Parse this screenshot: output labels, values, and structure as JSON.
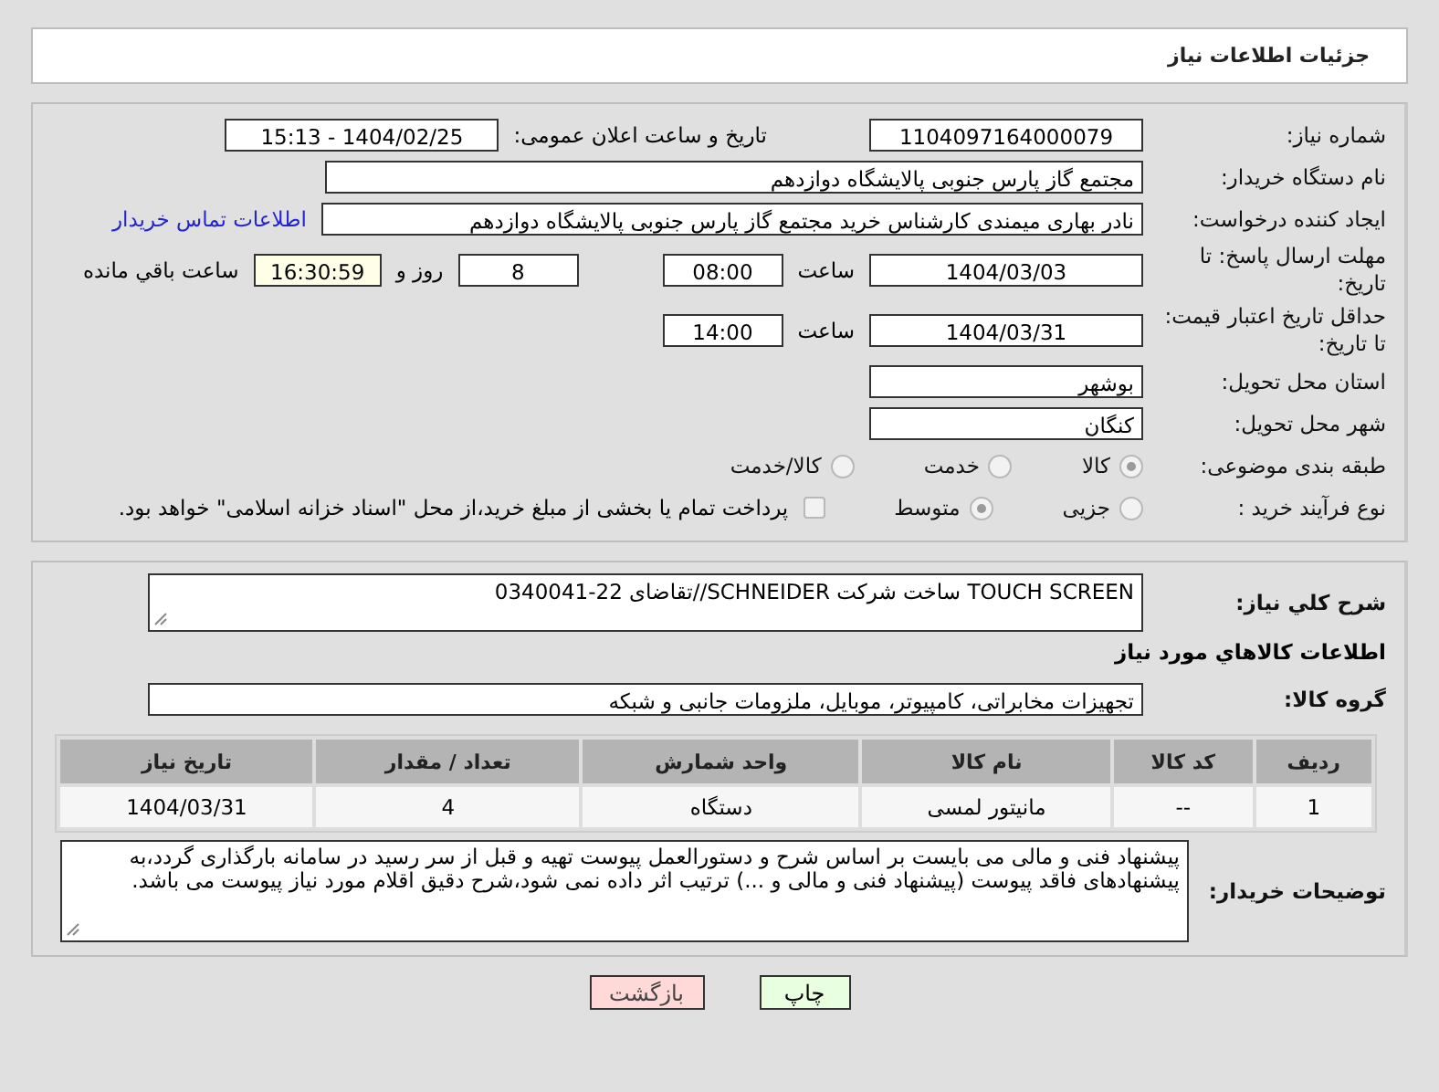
{
  "header": {
    "title": "جزئیات اطلاعات نیاز"
  },
  "need_number": {
    "label": "شماره نیاز:",
    "value": "1104097164000079"
  },
  "announce": {
    "label": "تاریخ و ساعت اعلان عمومی:",
    "value": "1404/02/25 - 15:13"
  },
  "buyer": {
    "label": "نام دستگاه خریدار:",
    "value": "مجتمع گاز پارس جنوبی  پالایشگاه دوازدهم"
  },
  "creator": {
    "label": "ایجاد کننده درخواست:",
    "value": "نادر بهاری میمندی کارشناس خرید مجتمع گاز پارس جنوبی  پالایشگاه دوازدهم",
    "link": "اطلاعات تماس خریدار"
  },
  "deadline": {
    "label": "مهلت ارسال پاسخ: تا تاریخ:",
    "date": "1404/03/03",
    "time_label": "ساعت",
    "time": "08:00",
    "days": "8",
    "days_label": "روز و",
    "remaining": "16:30:59",
    "remaining_label": "ساعت باقي مانده"
  },
  "validity": {
    "label": "حداقل تاریخ اعتبار قیمت: تا تاریخ:",
    "date": "1404/03/31",
    "time_label": "ساعت",
    "time": "14:00"
  },
  "province": {
    "label": "استان محل تحویل:",
    "value": "بوشهر"
  },
  "city": {
    "label": "شهر محل تحویل:",
    "value": "کنگان"
  },
  "category": {
    "label": "طبقه بندی موضوعی:",
    "options": [
      {
        "label": "کالا",
        "selected": true
      },
      {
        "label": "خدمت",
        "selected": false
      },
      {
        "label": "کالا/خدمت",
        "selected": false
      }
    ]
  },
  "process": {
    "label": "نوع فرآیند خرید :",
    "options": [
      {
        "label": "جزیی",
        "selected": false
      },
      {
        "label": "متوسط",
        "selected": true
      }
    ],
    "payment": {
      "checked": false,
      "text": "پرداخت تمام یا بخشی از مبلغ خرید،از محل \"اسناد خزانه اسلامی\" خواهد بود."
    }
  },
  "description": {
    "label": "شرح کلي نياز:",
    "value": "TOUCH SCREEN ساخت شرکت SCHNEIDER//تقاضای 22-0340041"
  },
  "goods_title": "اطلاعات کالاهاي مورد نياز",
  "goods_group": {
    "label": "گروه کالا:",
    "value": "تجهیزات مخابراتی، کامپیوتر، موبایل، ملزومات جانبی و شبکه"
  },
  "table": {
    "columns": [
      "ردیف",
      "کد کالا",
      "نام کالا",
      "واحد شمارش",
      "تعداد / مقدار",
      "تاریخ نیاز"
    ],
    "rows": [
      [
        "1",
        "--",
        "مانیتور لمسی",
        "دستگاه",
        "4",
        "1404/03/31"
      ]
    ]
  },
  "notes": {
    "label": "توضیحات خریدار:",
    "value": "پیشنهاد فنی و مالی می بایست بر اساس شرح و دستورالعمل پیوست تهیه و قبل از سر رسید در سامانه بارگذاری گردد،به پیشنهادهای فاقد پیوست (پیشنهاد فنی و مالی و ...) ترتیب اثر داده نمی شود،شرح دقیق اقلام مورد نیاز پیوست می باشد."
  },
  "buttons": [
    {
      "label": "چاپ",
      "kind": "print"
    },
    {
      "label": "بازگشت",
      "kind": "back"
    }
  ]
}
